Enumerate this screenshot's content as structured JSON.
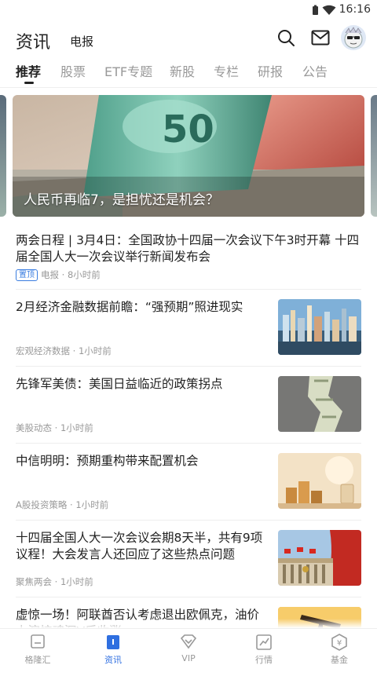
{
  "status_bar": {
    "time": "16:16"
  },
  "header": {
    "title": "资讯",
    "subtitle": "电报"
  },
  "tabs": [
    {
      "label": "推荐",
      "active": true
    },
    {
      "label": "股票"
    },
    {
      "label": "ETF专题"
    },
    {
      "label": "新股"
    },
    {
      "label": "专栏"
    },
    {
      "label": "研报"
    },
    {
      "label": "公告"
    }
  ],
  "banner": {
    "caption": "人民币再临7，是担忧还是机会？"
  },
  "pinned": {
    "headline": "两会日程 | 3月4日：全国政协十四届一次会议下午3时开幕 十四届全国人大一次会议举行新闻发布会",
    "tag": "置顶",
    "meta": "电报 · 8小时前"
  },
  "news": [
    {
      "headline": "2月经济金融数据前瞻：“强预期”照进现实",
      "meta": "宏观经济数据 · 1小时前",
      "thumb": "city-skyline"
    },
    {
      "headline": "先锋军美债：美国日益临近的政策拐点",
      "meta": "美股动态 · 1小时前",
      "thumb": "dollar-roll"
    },
    {
      "headline": "中信明明：预期重构带来配置机会",
      "meta": "A股投资策略 · 1小时前",
      "thumb": "coin-stacks"
    },
    {
      "headline": "十四届全国人大一次会议会期8天半，共有9项议程！大会发言人还回应了这些热点问题",
      "meta": "聚焦两会 · 1小时前",
      "thumb": "great-hall"
    },
    {
      "headline": "虚惊一场！阿联酋否认考虑退出欧佩克，油价上演惊魂深V后收涨",
      "meta": "",
      "thumb": "oil-pump"
    }
  ],
  "bottom_nav": [
    {
      "label": "格隆汇",
      "icon": "message-icon"
    },
    {
      "label": "资讯",
      "icon": "news-icon",
      "active": true
    },
    {
      "label": "VIP",
      "icon": "vip-icon"
    },
    {
      "label": "行情",
      "icon": "chart-icon"
    },
    {
      "label": "基金",
      "icon": "fund-icon"
    }
  ],
  "colors": {
    "accent": "#2f6fe0",
    "text": "#222222",
    "muted": "#999999"
  }
}
